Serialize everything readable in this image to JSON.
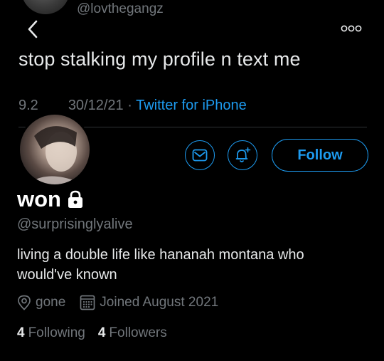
{
  "tweet": {
    "handle": "@lovthegangz",
    "text": "stop stalking my profile n text me",
    "meta_time_partial": "9.2",
    "meta_date": "30/12/21",
    "meta_sep": " · ",
    "meta_source": "Twitter for iPhone"
  },
  "profile": {
    "display_name": "won",
    "handle": "@surprisinglyalive",
    "bio": "living a double life like hananah montana who would've known",
    "location": "gone",
    "joined": "Joined August 2021",
    "following_count": "4",
    "following_label": "Following",
    "followers_count": "4",
    "followers_label": "Followers",
    "follow_button": "Follow"
  },
  "colors": {
    "background": "#000000",
    "accent": "#1d9bf0",
    "muted": "#71767b",
    "text": "#e7e9ea"
  },
  "icons": [
    "back-arrow-icon",
    "more-icon",
    "mail-icon",
    "bell-plus-icon",
    "lock-icon",
    "location-pin-icon",
    "calendar-icon"
  ]
}
